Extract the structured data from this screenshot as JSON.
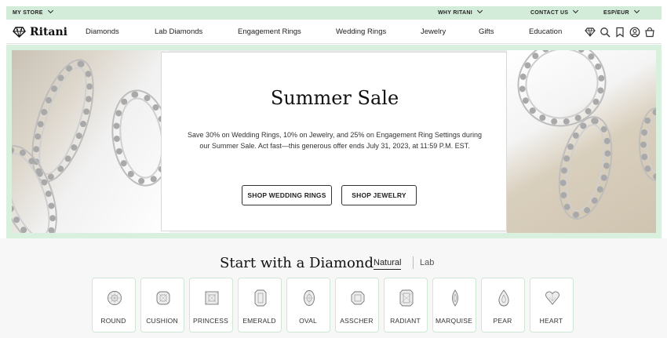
{
  "topbar": {
    "store": "MY STORE",
    "why": "WHY RITANI",
    "contact": "CONTACT US",
    "currency": "ESP/EUR"
  },
  "nav": {
    "brand": "Ritani",
    "links": [
      "Diamonds",
      "Lab Diamonds",
      "Engagement Rings",
      "Wedding Rings",
      "Jewelry",
      "Gifts",
      "Education"
    ],
    "icons": [
      "diamond-icon",
      "search-icon",
      "bookmark-icon",
      "account-icon",
      "cart-icon"
    ]
  },
  "hero": {
    "title": "Summer Sale",
    "body": "Save 30% on Wedding Rings, 10% on Jewelry, and 25% on Engagement Ring Settings during our Summer Sale. Act fast—this generous offer ends July 31, 2023, at 11:59 P.M. EST.",
    "btn_wedding": "SHOP WEDDING RINGS",
    "btn_jewelry": "SHOP JEWELRY"
  },
  "diamond_section": {
    "title": "Start with a Diamond",
    "tab_natural": "Natural",
    "tab_lab": "Lab",
    "shapes": [
      "ROUND",
      "CUSHION",
      "PRINCESS",
      "EMERALD",
      "OVAL",
      "ASSCHER",
      "RADIANT",
      "MARQUISE",
      "PEAR",
      "HEART"
    ]
  },
  "colors": {
    "accent_green": "#d3ecd9",
    "card_border": "#cfe8d5"
  }
}
